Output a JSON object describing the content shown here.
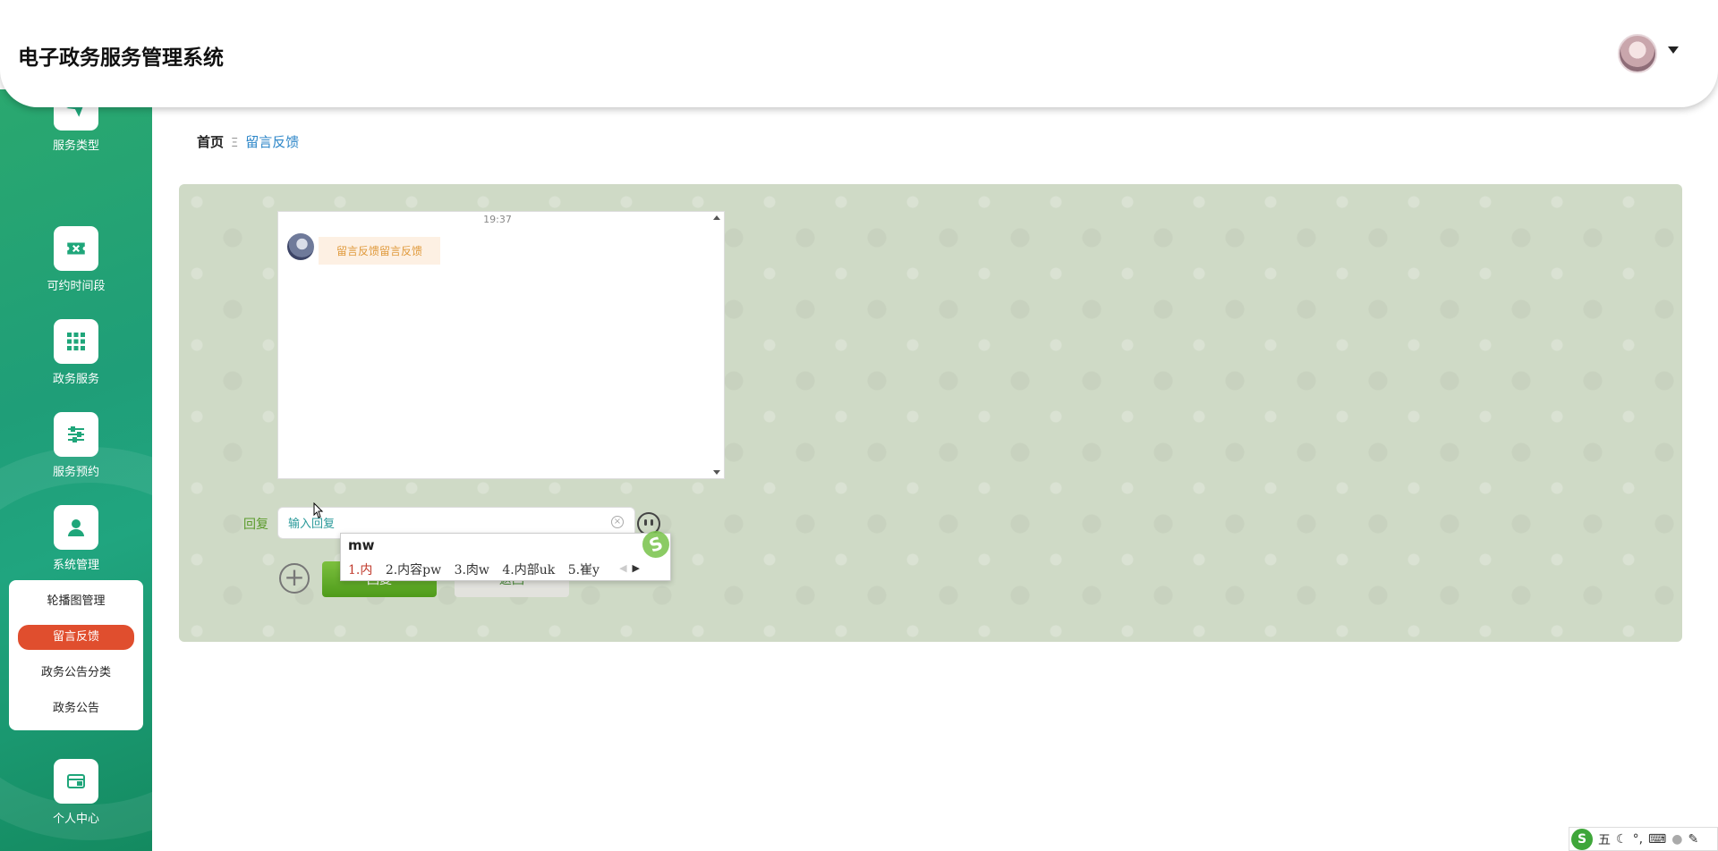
{
  "app": {
    "title": "电子政务服务管理系统"
  },
  "header": {
    "avatar_icon": "user-avatar",
    "dropdown_icon": "caret-down-icon"
  },
  "sidebar": {
    "items": [
      {
        "label": "服务类型",
        "icon": "paper-plane-icon"
      },
      {
        "label": "可约时间段",
        "icon": "ticket-icon"
      },
      {
        "label": "政务服务",
        "icon": "grid-icon"
      },
      {
        "label": "服务预约",
        "icon": "sliders-icon"
      },
      {
        "label": "系统管理",
        "icon": "user-icon"
      },
      {
        "label": "个人中心",
        "icon": "wallet-icon"
      }
    ],
    "submenu": [
      {
        "label": "轮播图管理",
        "active": false
      },
      {
        "label": "留言反馈",
        "active": true
      },
      {
        "label": "政务公告分类",
        "active": false
      },
      {
        "label": "政务公告",
        "active": false
      }
    ],
    "active_color": "#e04e2e"
  },
  "breadcrumb": {
    "home": "首页",
    "separator": "Ξ",
    "current": "留言反馈"
  },
  "chat": {
    "time": "19:37",
    "messages": [
      {
        "text": "留言反馈留言反馈"
      }
    ]
  },
  "reply": {
    "label": "回复",
    "placeholder": "输入回复",
    "submit_label": "回复",
    "back_label": "返回"
  },
  "ime": {
    "input": "mw",
    "candidates": [
      "1.内",
      "2.内容pw",
      "3.肉w",
      "4.内部uk",
      "5.崔y"
    ],
    "toolbar": {
      "mode": "五"
    }
  }
}
